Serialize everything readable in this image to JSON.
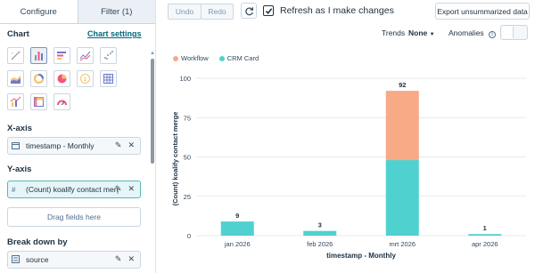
{
  "tabs": {
    "configure": "Configure",
    "filter": "Filter (1)"
  },
  "left": {
    "chart_heading": "Chart",
    "chart_settings_link": "Chart settings",
    "chart_types": [
      {
        "name": "magic-wand-icon"
      },
      {
        "name": "bar-chart-icon",
        "selected": true
      },
      {
        "name": "horizontal-bar-icon"
      },
      {
        "name": "line-chart-icon"
      },
      {
        "name": "scatter-icon"
      },
      {
        "name": "area-chart-icon"
      },
      {
        "name": "donut-icon"
      },
      {
        "name": "pie-icon"
      },
      {
        "name": "kpi-icon"
      },
      {
        "name": "table-icon"
      },
      {
        "name": "combo-chart-icon"
      },
      {
        "name": "pivot-icon"
      },
      {
        "name": "gauge-icon"
      }
    ],
    "xaxis_heading": "X-axis",
    "xaxis_field": "timestamp - Monthly",
    "yaxis_heading": "Y-axis",
    "yaxis_field": "(Count) koalify contact merge",
    "drag_placeholder": "Drag fields here",
    "breakdown_heading": "Break down by",
    "breakdown_field": "source"
  },
  "toolbar": {
    "undo": "Undo",
    "redo": "Redo",
    "refresh_label": "Refresh as I make changes",
    "refresh_checked": true,
    "export": "Export unsummarized data",
    "trends_label": "Trends",
    "trends_value": "None",
    "anomalies_label": "Anomalies"
  },
  "colors": {
    "workflow": "#f8a986",
    "crm_card": "#4fd1cf",
    "link": "#00687a"
  },
  "chart_data": {
    "type": "bar",
    "stacked": true,
    "categories": [
      "jan 2026",
      "feb 2026",
      "mrt 2026",
      "apr 2026"
    ],
    "series": [
      {
        "name": "Workflow",
        "values": [
          0,
          0,
          44,
          0
        ]
      },
      {
        "name": "CRM Card",
        "values": [
          9,
          3,
          48,
          1
        ]
      }
    ],
    "totals": [
      9,
      3,
      92,
      1
    ],
    "xlabel": "timestamp - Monthly",
    "ylabel": "(Count) koalify contact merge",
    "ylim": [
      0,
      100
    ],
    "yticks": [
      0,
      25,
      50,
      75,
      100
    ],
    "legend_position": "top-left",
    "grid": true
  }
}
